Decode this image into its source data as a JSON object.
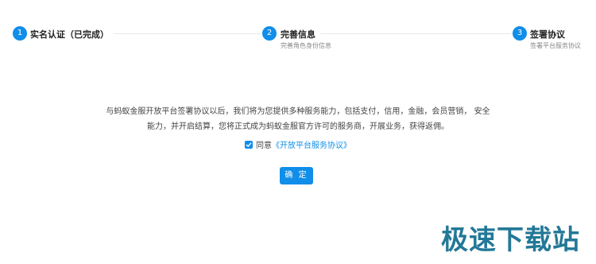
{
  "steps": [
    {
      "number": "1",
      "title": "实名认证（已完成）",
      "desc": ""
    },
    {
      "number": "2",
      "title": "完善信息",
      "desc": "完善角色身份信息"
    },
    {
      "number": "3",
      "title": "签署协议",
      "desc": "签署平台服务协议"
    }
  ],
  "notice": {
    "line1": "与蚂蚁金服开放平台签署协议以后，我们将为您提供多种服务能力，包括支付，信用，金融，会员营销， 安全",
    "line2": "能力，并开启结算，您将正式成为蚂蚁金服官方许可的服务商，开展业务，获得返佣。"
  },
  "agreement": {
    "checked": true,
    "prefix": "同意",
    "link_text": "《开放平台服务协议》"
  },
  "confirm_label": "确 定",
  "watermark": "极速下载站",
  "colors": {
    "accent": "#108ee9"
  }
}
